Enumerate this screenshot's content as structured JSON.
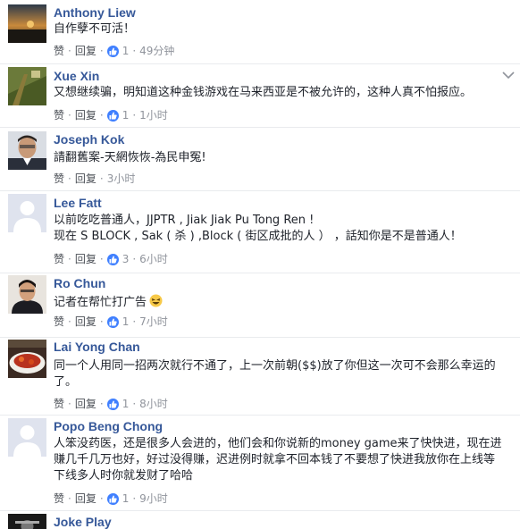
{
  "actions": {
    "like": "赞",
    "reply": "回复",
    "sep": "·"
  },
  "comments": [
    {
      "name": "Anthony Liew",
      "lines": [
        "自作孽不可活！"
      ],
      "likes": "1",
      "time": "49分钟"
    },
    {
      "name": "Xue Xin",
      "lines": [
        "又想继续骗，明知道这种金钱游戏在马来西亚是不被允许的，这种人真不怕报应。"
      ],
      "likes": "1",
      "time": "1小时"
    },
    {
      "name": "Joseph Kok",
      "lines": [
        "請翻舊案-天網恢恢-為民申冤!"
      ],
      "likes": "",
      "time": "3小时"
    },
    {
      "name": "Lee Fatt",
      "lines": [
        "以前吃吃普通人，JJPTR , Jiak Jiak Pu Tong Ren !",
        "现在 S BLOCK , Sak ( 杀 ) ,Block ( 街区成批的人 ） ，話知你是不是普通人！"
      ],
      "likes": "3",
      "time": "6小时"
    },
    {
      "name": "Ro Chun",
      "lines": [
        "记者在帮忙打广告"
      ],
      "likes": "1",
      "time": "7小时"
    },
    {
      "name": "Lai Yong Chan",
      "lines": [
        "同一个人用同一招两次就行不通了，上一次前朝($$)放了你但这一次可不会那么幸运的",
        "了。"
      ],
      "likes": "1",
      "time": "8小时"
    },
    {
      "name": "Popo Beng Chong",
      "lines": [
        "人笨没药医，还是很多人会进的，他们会和你说新的money game来了快快进，现在进",
        "赚几千几万也好，好过没得赚，迟进例时就拿不回本钱了不要想了快进我放你在上线等",
        "下线多人时你就发财了哈哈"
      ],
      "likes": "1",
      "time": "9小时"
    },
    {
      "name": "Joke Play",
      "lines": [],
      "likes": "",
      "time": ""
    }
  ],
  "colors": {
    "name": "#365899",
    "text": "#1d2129",
    "meta": "#90949c",
    "like": "#4080ff"
  },
  "icons": {
    "like": "thumbs-up-icon",
    "menu": "chevron-down-icon",
    "emoji": "laughing-emoji-icon"
  }
}
